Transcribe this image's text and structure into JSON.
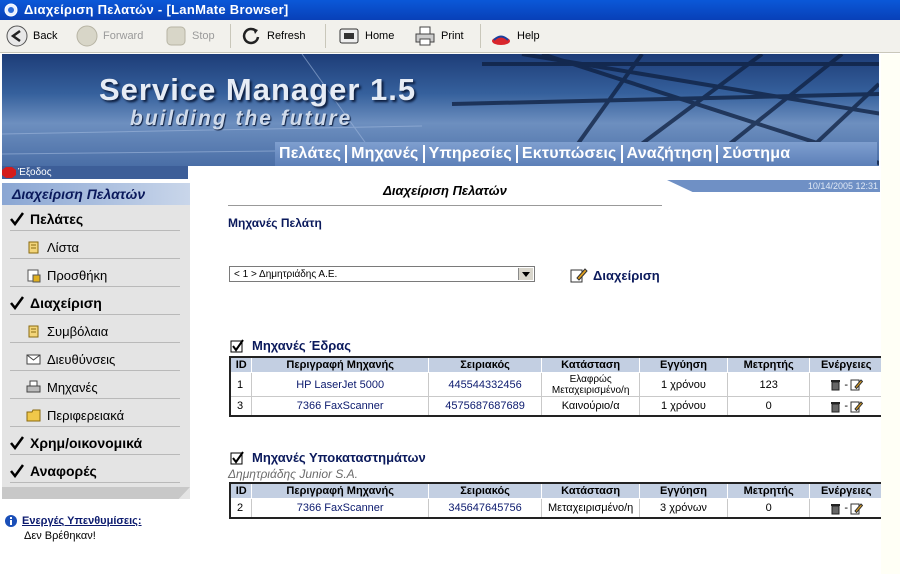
{
  "window": {
    "title": "Διαχείριση Πελατών - [LanMate Browser]"
  },
  "toolbar": {
    "back": "Back",
    "forward": "Forward",
    "stop": "Stop",
    "refresh": "Refresh",
    "home": "Home",
    "print": "Print",
    "help": "Help"
  },
  "banner": {
    "title": "Service Manager 1.5",
    "subtitle": "building the future",
    "nav": [
      "Πελάτες",
      "Μηχανές",
      "Υπηρεσίες",
      "Εκτυπώσεις",
      "Αναζήτηση",
      "Σύστημα"
    ]
  },
  "exit_label": "Έξοδος",
  "date": "10/14/2005 12:31",
  "sidebar": {
    "header": "Διαχείριση Πελατών",
    "items": [
      {
        "label": "Πελάτες",
        "icon": "checkmark-icon"
      },
      {
        "label": "Λίστα",
        "icon": "scroll-icon"
      },
      {
        "label": "Προσθήκη",
        "icon": "add-doc-icon"
      },
      {
        "label": "Διαχείριση",
        "icon": "checkmark-icon"
      },
      {
        "label": "Συμβόλαια",
        "icon": "scroll-icon"
      },
      {
        "label": "Διευθύνσεις",
        "icon": "envelope-icon"
      },
      {
        "label": "Μηχανές",
        "icon": "printer-icon"
      },
      {
        "label": "Περιφερειακά",
        "icon": "folder-icon"
      },
      {
        "label": "Χρημ/οικονομικά",
        "icon": "checkmark-icon"
      },
      {
        "label": "Αναφορές",
        "icon": "checkmark-icon"
      }
    ]
  },
  "reminders": {
    "heading": "Ενεργές Υπενθυμίσεις:",
    "value": "Δεν Βρέθηκαν!"
  },
  "main": {
    "title": "Διαχείριση Πελατών",
    "section_title": "Μηχανές Πελάτη",
    "customer_select": "< 1 > Δημητριάδης Α.Ε.",
    "manage_label": "Διαχείριση",
    "columns": [
      "ID",
      "Περιγραφή Μηχανής",
      "Σειριακός",
      "Κατάσταση",
      "Εγγύηση",
      "Μετρητής",
      "Ενέργειες"
    ],
    "hq": {
      "title": "Μηχανές Έδρας",
      "rows": [
        {
          "id": "1",
          "desc": "HP LaserJet 5000",
          "serial": "445544332456",
          "status": "Ελαφρώς Μεταχειρισμένο/η",
          "warranty": "1 χρόνου",
          "counter": "123"
        },
        {
          "id": "3",
          "desc": "7366 FaxScanner",
          "serial": "4575687687689",
          "status": "Καινούριο/α",
          "warranty": "1 χρόνου",
          "counter": "0"
        }
      ]
    },
    "branch": {
      "title": "Μηχανές Υποκαταστημάτων",
      "branch_name": "Δημητριάδης Junior S.A.",
      "rows": [
        {
          "id": "2",
          "desc": "7366 FaxScanner",
          "serial": "345647645756",
          "status": "Μεταχειρισμένο/η",
          "warranty": "3 χρόνων",
          "counter": "0"
        }
      ]
    },
    "action_separator": "-"
  },
  "colors": {
    "nav_blue": "#5c7fb8",
    "header_blue": "#c3cfe2",
    "title_navy": "#0b1a5c"
  }
}
